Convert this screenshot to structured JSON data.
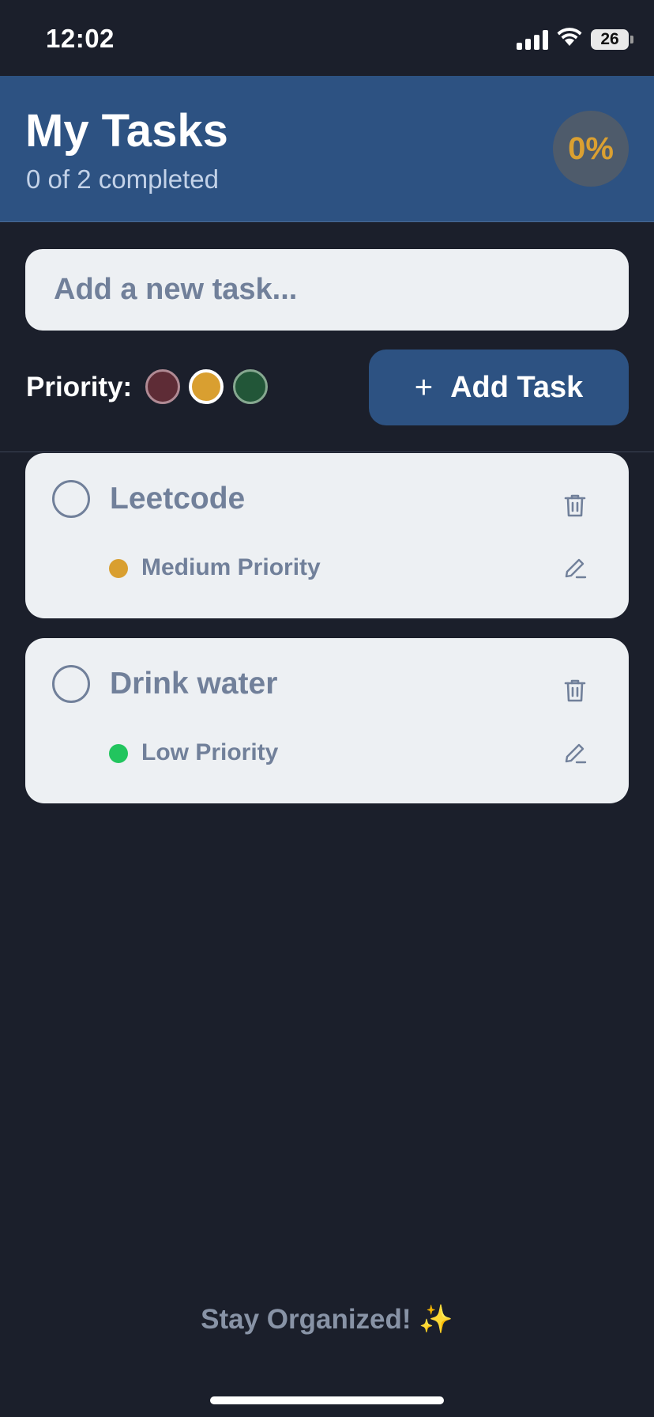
{
  "status_bar": {
    "time": "12:02",
    "battery": "26",
    "icons": [
      "signal-icon",
      "wifi-icon",
      "battery-icon"
    ]
  },
  "header": {
    "title": "My Tasks",
    "subtitle": "0 of 2 completed",
    "progress": "0%"
  },
  "input": {
    "placeholder": "Add a new task...",
    "value": ""
  },
  "priority": {
    "label": "Priority:",
    "options": [
      {
        "level": "high",
        "color": "#5e2c36"
      },
      {
        "level": "medium",
        "color": "#d99f30",
        "selected": true
      },
      {
        "level": "low",
        "color": "#225638"
      }
    ]
  },
  "add_button": {
    "label": "Add Task",
    "icon": "plus-icon"
  },
  "tasks": [
    {
      "title": "Leetcode",
      "priority_label": "Medium Priority",
      "priority_color": "#d99f30",
      "completed": false
    },
    {
      "title": "Drink water",
      "priority_label": "Low Priority",
      "priority_color": "#22c55e",
      "completed": false
    }
  ],
  "footer": {
    "text": "Stay Organized!",
    "emoji": "✨"
  },
  "colors": {
    "background": "#1b1f2b",
    "header": "#2d5282",
    "accent": "#d99f30",
    "card": "#edf0f3",
    "muted_text": "#71809a"
  }
}
